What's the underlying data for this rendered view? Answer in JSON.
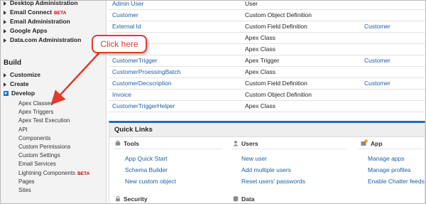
{
  "sidebar": {
    "top_items": [
      {
        "label": "Desktop Administration",
        "beta": ""
      },
      {
        "label": "Email Connect",
        "beta": "BETA"
      },
      {
        "label": "Email Administration",
        "beta": ""
      },
      {
        "label": "Google Apps",
        "beta": ""
      },
      {
        "label": "Data.com Administration",
        "beta": ""
      }
    ],
    "build_heading": "Build",
    "build_items": [
      "Customize",
      "Create",
      "Develop"
    ],
    "develop_subitems": [
      {
        "label": "Apex Classes",
        "beta": ""
      },
      {
        "label": "Apex Triggers",
        "beta": ""
      },
      {
        "label": "Apex Test Execution",
        "beta": ""
      },
      {
        "label": "API",
        "beta": ""
      },
      {
        "label": "Components",
        "beta": ""
      },
      {
        "label": "Custom Permissions",
        "beta": ""
      },
      {
        "label": "Custom Settings",
        "beta": ""
      },
      {
        "label": "Email Services",
        "beta": ""
      },
      {
        "label": "Lightning Components",
        "beta": "BETA"
      },
      {
        "label": "Pages",
        "beta": ""
      },
      {
        "label": "Sites",
        "beta": ""
      }
    ]
  },
  "callout": {
    "text": "Click here",
    "color": "#e03c2b"
  },
  "recent_items": [
    {
      "name": "Admin User",
      "type": "User",
      "object": ""
    },
    {
      "name": "Customer",
      "type": "Custom Object Definition",
      "object": ""
    },
    {
      "name": "External Id",
      "type": "Custom Field Definition",
      "object": "Customer"
    },
    {
      "name": "",
      "type": "Apex Class",
      "object": ""
    },
    {
      "name": "",
      "type": "Apex Class",
      "object": ""
    },
    {
      "name": "CustomerTrigger",
      "type": "Apex Trigger",
      "object": "Customer"
    },
    {
      "name": "CustomerProessingBatch",
      "type": "Apex Class",
      "object": ""
    },
    {
      "name": "CustomerDecscription",
      "type": "Custom Field Definition",
      "object": "Customer"
    },
    {
      "name": "Invoice",
      "type": "Custom Object Definition",
      "object": ""
    },
    {
      "name": "CustomerTriggerHelper",
      "type": "Apex Class",
      "object": ""
    }
  ],
  "quick_links": {
    "title": "Quick Links",
    "tools": {
      "title": "Tools",
      "links": [
        "App Quick Start",
        "Schema Builder",
        "New custom object"
      ]
    },
    "users": {
      "title": "Users",
      "links": [
        "New user",
        "Add multiple users",
        "Reset users' passwords"
      ]
    },
    "app": {
      "title": "App",
      "links": [
        "Manage apps",
        "Manage profiles",
        "Enable Chatter feeds"
      ]
    },
    "security": {
      "title": "Security"
    },
    "data": {
      "title": "Data"
    }
  },
  "colors": {
    "link": "#1f5fa5",
    "accent": "#1d6fc0",
    "beta": "#cc0000"
  }
}
